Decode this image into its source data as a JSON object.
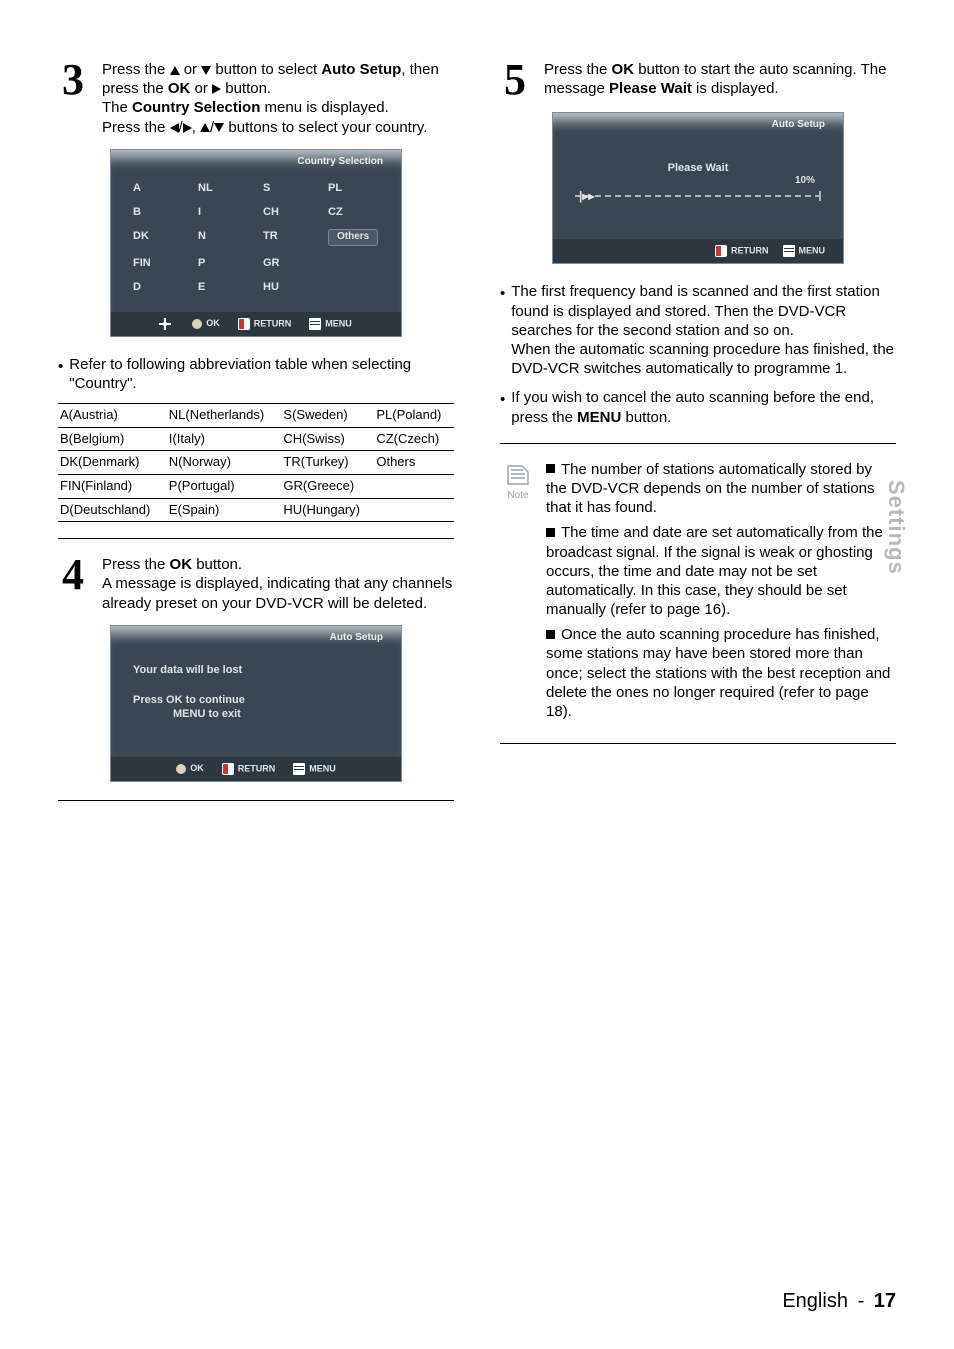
{
  "step3": {
    "num": "3",
    "txt1a": "Press the ",
    "txt1b": " or ",
    "txt1c": " button to select ",
    "auto_setup": "Auto Setup",
    "txt1d": ", then press the ",
    "ok": "OK",
    "txt1e": " or ",
    "txt1f": " button.",
    "txt2a": "The ",
    "cs": "Country Selection",
    "txt2b": " menu is displayed.",
    "txt3a": "Press the ",
    "comma": ", ",
    "txt3b": " buttons to select your country."
  },
  "osd_cs": {
    "title": "Country Selection",
    "cells": [
      "A",
      "NL",
      "S",
      "PL",
      "B",
      "I",
      "CH",
      "CZ",
      "DK",
      "N",
      "TR",
      "Others",
      "FIN",
      "P",
      "GR",
      "",
      "D",
      "E",
      "HU",
      ""
    ],
    "ok": "OK",
    "return": "RETURN",
    "menu": "MENU"
  },
  "bullet3": "Refer to following abbreviation table when selecting \"Country\".",
  "abbr": {
    "r1": [
      "A(Austria)",
      "NL(Netherlands)",
      "S(Sweden)",
      "PL(Poland)"
    ],
    "r2": [
      "B(Belgium)",
      "I(Italy)",
      "CH(Swiss)",
      "CZ(Czech)"
    ],
    "r3": [
      "DK(Denmark)",
      "N(Norway)",
      "TR(Turkey)",
      "Others"
    ],
    "r4": [
      "FIN(Finland)",
      "P(Portugal)",
      "GR(Greece)",
      ""
    ],
    "r5": [
      "D(Deutschland)",
      "E(Spain)",
      "HU(Hungary)",
      ""
    ]
  },
  "step4": {
    "num": "4",
    "txt1a": "Press the ",
    "ok": "OK",
    "txt1b": " button.",
    "txt2": "A message is displayed, indicating that any channels already preset on your DVD-VCR will be deleted."
  },
  "osd_warn": {
    "title": "Auto Setup",
    "l1": "Your data will be lost",
    "l2": "Press OK  to continue",
    "l3": "MENU  to exit",
    "ok": "OK",
    "return": "RETURN",
    "menu": "MENU"
  },
  "step5": {
    "num": "5",
    "txt1a": "Press the ",
    "ok": "OK",
    "txt1b": " button to start the auto scanning. The message ",
    "pw": "Please Wait",
    "txt1c": " is displayed."
  },
  "osd_prog": {
    "title": "Auto Setup",
    "pw": "Please Wait",
    "pct": "10%",
    "return": "RETURN",
    "menu": "MENU"
  },
  "after5": {
    "b1": "The first frequency band is scanned and the first station found is displayed and stored. Then the DVD-VCR searches for the second station and so on.",
    "b1b": "When the automatic scanning procedure has finished, the DVD-VCR switches automatically to programme 1.",
    "b2a": "If you wish to cancel the auto scanning before the end, press the ",
    "menu": "MENU",
    "b2b": " button."
  },
  "note_label": "Note",
  "notes": {
    "n1": "The number of stations automatically stored by the DVD-VCR depends on the number of stations that it has found.",
    "n2a": "The time and date are set automatically from the broadcast signal. If the signal is weak or ghosting occurs, the time and date may not be set automatically. In this case, they should be set manually (refer to page ",
    "n2p": "16",
    "n2b": ").",
    "n3a": "Once the auto scanning procedure has finished, some stations may have been stored more than once; select the stations with the best reception and delete the ones no longer required (refer to page ",
    "n3p": "18",
    "n3b": ")."
  },
  "side": "Settings",
  "footer": {
    "lang": "English",
    "dash": "-",
    "page": "17"
  }
}
